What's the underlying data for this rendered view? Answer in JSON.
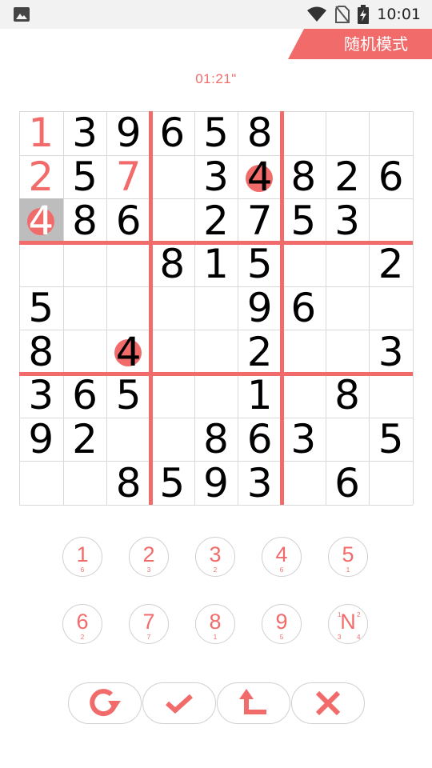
{
  "status_bar": {
    "time": "10:01"
  },
  "header": {
    "mode_label": "随机模式"
  },
  "timer": "01:21\"",
  "colors": {
    "accent": "#f26b6b",
    "selected_bg": "#bdbdbd",
    "grid_line": "#d8d8d8"
  },
  "board": {
    "rows": [
      [
        "1",
        "3",
        "9",
        "6",
        "5",
        "8",
        "",
        "",
        ""
      ],
      [
        "2",
        "5",
        "7",
        "",
        "3",
        "4",
        "8",
        "2",
        "6"
      ],
      [
        "4",
        "8",
        "6",
        "",
        "2",
        "7",
        "5",
        "3",
        ""
      ],
      [
        "",
        "",
        "",
        "8",
        "1",
        "5",
        "",
        "",
        "2"
      ],
      [
        "5",
        "",
        "",
        "",
        "",
        "9",
        "6",
        "",
        ""
      ],
      [
        "8",
        "",
        "4",
        "",
        "",
        "2",
        "",
        "",
        "3"
      ],
      [
        "3",
        "6",
        "5",
        "",
        "",
        "1",
        "",
        "8",
        ""
      ],
      [
        "9",
        "2",
        "",
        "",
        "8",
        "6",
        "3",
        "",
        "5"
      ],
      [
        "",
        "",
        "8",
        "5",
        "9",
        "3",
        "",
        "6",
        ""
      ]
    ],
    "user_cells": [
      [
        0,
        0
      ],
      [
        1,
        0
      ],
      [
        1,
        2
      ],
      [
        2,
        0
      ]
    ],
    "selected_cell": [
      2,
      0
    ],
    "conflict_cells": [
      [
        1,
        5
      ],
      [
        2,
        0
      ],
      [
        5,
        2
      ]
    ]
  },
  "number_pad": [
    {
      "digit": "1",
      "remaining": "6"
    },
    {
      "digit": "2",
      "remaining": "3"
    },
    {
      "digit": "3",
      "remaining": "2"
    },
    {
      "digit": "4",
      "remaining": "6"
    },
    {
      "digit": "5",
      "remaining": "1"
    },
    {
      "digit": "6",
      "remaining": "2"
    },
    {
      "digit": "7",
      "remaining": "7"
    },
    {
      "digit": "8",
      "remaining": "1"
    },
    {
      "digit": "9",
      "remaining": "5"
    }
  ],
  "notes_button": {
    "label": "N",
    "corners": [
      "1",
      "2",
      "3",
      "4"
    ]
  },
  "actions": [
    {
      "id": "restart",
      "icon": "refresh-icon"
    },
    {
      "id": "check",
      "icon": "checkmark-icon"
    },
    {
      "id": "undo",
      "icon": "undo-arrow-icon"
    },
    {
      "id": "clear",
      "icon": "close-icon"
    }
  ]
}
